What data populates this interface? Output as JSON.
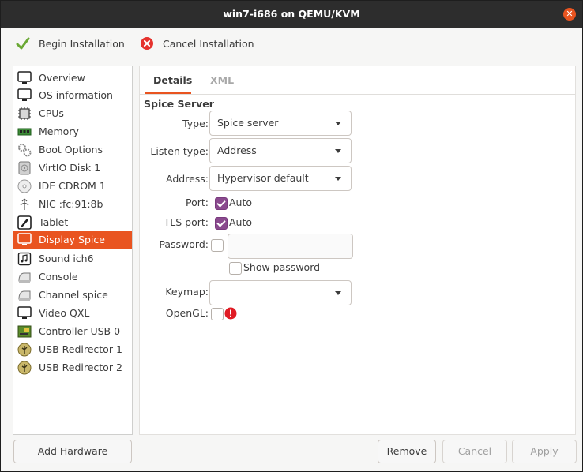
{
  "window": {
    "title": "win7-i686 on QEMU/KVM",
    "close_icon": "close-icon"
  },
  "toolbar": {
    "begin_label": "Begin Installation",
    "begin_icon": "checkmark-icon",
    "cancel_label": "Cancel Installation",
    "cancel_icon": "cancel-icon"
  },
  "sidebar": {
    "selected_index": 9,
    "items": [
      {
        "label": "Overview",
        "icon": "monitor-icon"
      },
      {
        "label": "OS information",
        "icon": "monitor-icon"
      },
      {
        "label": "CPUs",
        "icon": "cpu-icon"
      },
      {
        "label": "Memory",
        "icon": "memory-icon"
      },
      {
        "label": "Boot Options",
        "icon": "gears-icon"
      },
      {
        "label": "VirtIO Disk 1",
        "icon": "disk-icon"
      },
      {
        "label": "IDE CDROM 1",
        "icon": "cdrom-icon"
      },
      {
        "label": "NIC :fc:91:8b",
        "icon": "network-icon"
      },
      {
        "label": "Tablet",
        "icon": "tablet-icon"
      },
      {
        "label": "Display Spice",
        "icon": "display-icon"
      },
      {
        "label": "Sound ich6",
        "icon": "sound-icon"
      },
      {
        "label": "Console",
        "icon": "console-icon"
      },
      {
        "label": "Channel spice",
        "icon": "channel-icon"
      },
      {
        "label": "Video QXL",
        "icon": "monitor-icon"
      },
      {
        "label": "Controller USB 0",
        "icon": "controller-icon"
      },
      {
        "label": "USB Redirector 1",
        "icon": "usb-icon"
      },
      {
        "label": "USB Redirector 2",
        "icon": "usb-icon"
      }
    ],
    "add_hardware_label": "Add Hardware"
  },
  "tabs": [
    {
      "label": "Details",
      "active": true
    },
    {
      "label": "XML",
      "active": false
    }
  ],
  "spice": {
    "section_title": "Spice Server",
    "type_label": "Type:",
    "type_value": "Spice server",
    "listen_label": "Listen type:",
    "listen_value": "Address",
    "address_label": "Address:",
    "address_value": "Hypervisor default",
    "port_label": "Port:",
    "port_auto_label": "Auto",
    "port_auto_checked": true,
    "tls_label": "TLS port:",
    "tls_auto_label": "Auto",
    "tls_auto_checked": true,
    "password_label": "Password:",
    "password_checked": false,
    "password_value": "",
    "show_password_label": "Show password",
    "show_password_checked": false,
    "keymap_label": "Keymap:",
    "keymap_value": "",
    "opengl_label": "OpenGL:",
    "opengl_checked": false,
    "opengl_warning_icon": "warning-icon"
  },
  "buttons": {
    "remove_label": "Remove",
    "cancel_label": "Cancel",
    "apply_label": "Apply"
  },
  "colors": {
    "accent": "#e95420",
    "checkbox_on": "#8a4a8e",
    "titlebar": "#2d2d2d"
  }
}
